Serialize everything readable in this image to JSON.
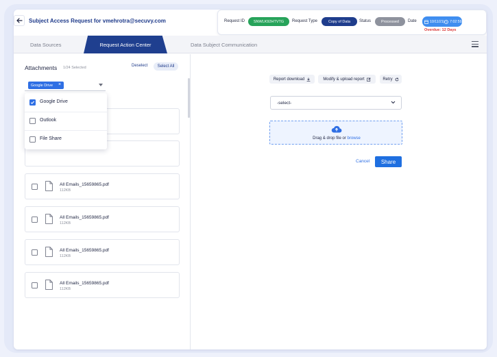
{
  "header": {
    "title": "Subject Access Request for vmehrotra@secuvy.com",
    "request_id_label": "Request ID",
    "request_id": "SNWLK92HTVTG",
    "request_type_label": "Request Type",
    "request_type": "Copy of Data",
    "status_label": "Status",
    "status": "Processed",
    "date_label": "Date",
    "date": "10/11/21",
    "time": "7:02:59AM",
    "overdue": "Overdue: 12 Days",
    "colors": {
      "id_pill": "#27a35a",
      "type_pill": "#1f3d8c",
      "status_pill": "#8e929d",
      "date_pill": "#3f8ef0",
      "overdue": "#d93636"
    }
  },
  "tabs": [
    {
      "label": "Data Sources",
      "active": false
    },
    {
      "label": "Request Action Center",
      "active": true
    },
    {
      "label": "Data Subject Communication",
      "active": false
    }
  ],
  "attachments": {
    "title": "Attachments",
    "count": "1/24 Selected",
    "deselect_label": "Deselect",
    "select_all_label": "Select All",
    "filter_chip": "Google Drive",
    "dropdown": [
      {
        "label": "Google Drive",
        "checked": true
      },
      {
        "label": "Outlook",
        "checked": false
      },
      {
        "label": "File Share",
        "checked": false
      }
    ],
    "files": [
      {
        "name": "All Emails_15659865.pdf",
        "size": "112KB"
      },
      {
        "name": "All Emails_15659865.pdf",
        "size": "112KB"
      },
      {
        "name": "All Emails_15659865.pdf",
        "size": "112KB"
      },
      {
        "name": "All Emails_15659865.pdf",
        "size": "112KB"
      }
    ]
  },
  "actions": {
    "report_download": "Report download",
    "modify_upload": "Modify & upload report",
    "retry": "Retry",
    "select_placeholder": "-select-",
    "drop_text": "Drag & drop file or",
    "browse": "browse",
    "cancel": "Cancel",
    "share": "Share"
  }
}
